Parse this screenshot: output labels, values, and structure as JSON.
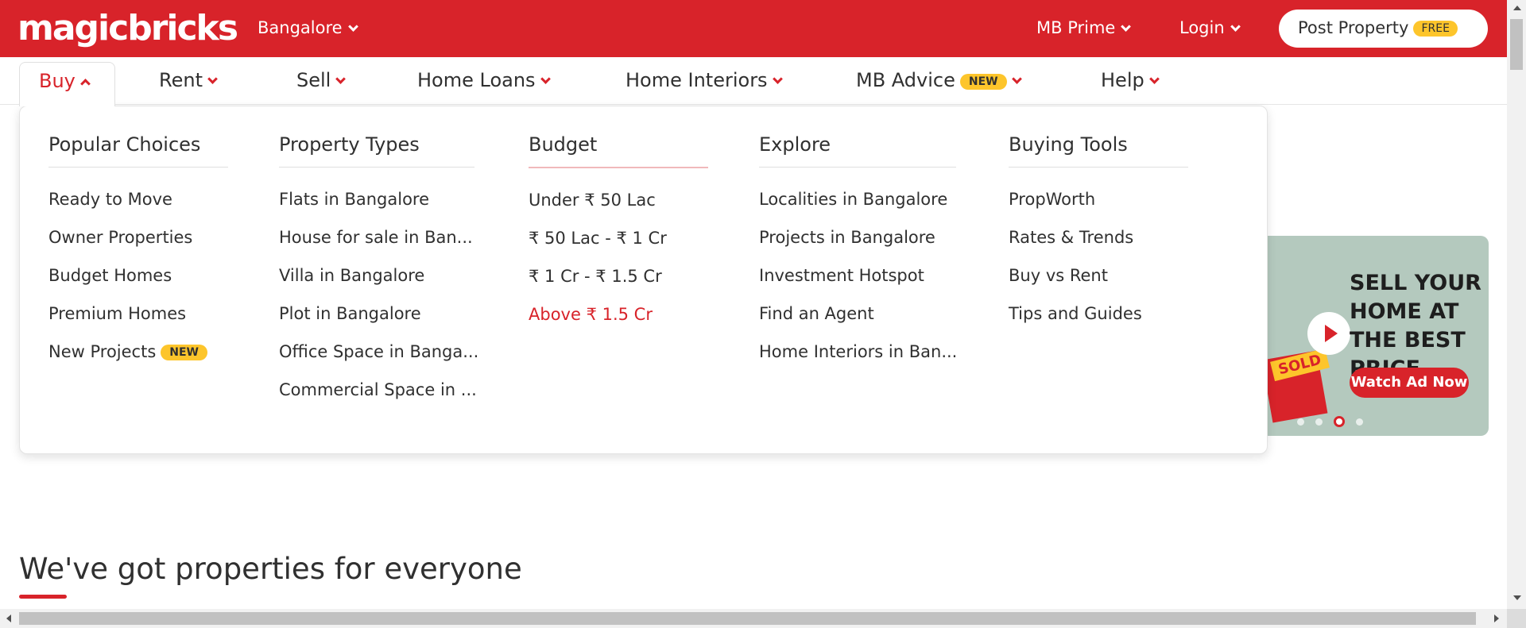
{
  "header": {
    "logo": "magicbricks",
    "city": "Bangalore",
    "mb_prime": "MB Prime",
    "login": "Login",
    "post_property": "Post Property",
    "free_badge": "FREE"
  },
  "nav": {
    "buy": "Buy",
    "rent": "Rent",
    "sell": "Sell",
    "home_loans": "Home Loans",
    "home_interiors": "Home Interiors",
    "mb_advice": "MB Advice",
    "mb_advice_badge": "NEW",
    "help": "Help"
  },
  "dropdown": {
    "popular": {
      "title": "Popular Choices",
      "items": [
        "Ready to Move",
        "Owner Properties",
        "Budget Homes",
        "Premium Homes",
        "New Projects"
      ],
      "new_badge": "NEW"
    },
    "property_types": {
      "title": "Property Types",
      "items": [
        "Flats in Bangalore",
        "House for sale in Ban...",
        "Villa in Bangalore",
        "Plot in Bangalore",
        "Office Space in Banga...",
        "Commercial Space in ..."
      ]
    },
    "budget": {
      "title": "Budget",
      "items": [
        "Under ₹ 50 Lac",
        "₹ 50 Lac - ₹ 1 Cr",
        "₹ 1 Cr - ₹ 1.5 Cr",
        "Above ₹ 1.5 Cr"
      ]
    },
    "explore": {
      "title": "Explore",
      "items": [
        "Localities in Bangalore",
        "Projects in Bangalore",
        "Investment Hotspot",
        "Find an Agent",
        "Home Interiors in Ban..."
      ]
    },
    "buying_tools": {
      "title": "Buying Tools",
      "items": [
        "PropWorth",
        "Rates & Trends",
        "Buy vs Rent",
        "Tips and Guides"
      ]
    }
  },
  "banner": {
    "headline": "SELL YOUR HOME AT THE BEST PRICE",
    "cta": "Watch Ad Now",
    "sold_tag": "SOLD",
    "active_slide": 3,
    "slide_count": 4
  },
  "main": {
    "heading": "We've got properties for everyone"
  },
  "colors": {
    "brand_red": "#d8232a",
    "badge_yellow": "#fdc52b"
  }
}
